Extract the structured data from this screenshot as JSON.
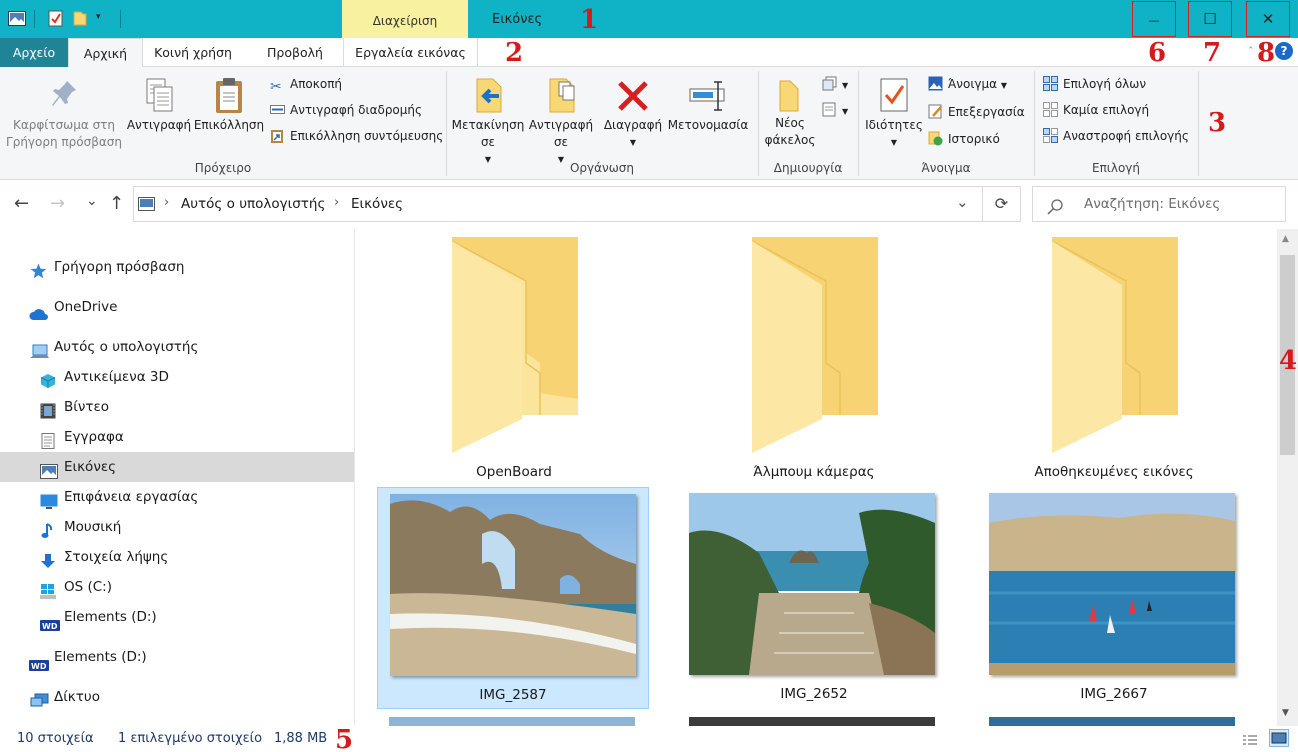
{
  "titlebar": {
    "quick_access_toolbar": [
      "properties-icon",
      "new-folder-icon",
      "customize-dropdown"
    ],
    "manage_tab": "Διαχείριση",
    "title": "Εικόνες",
    "minimize": "—",
    "maximize": "☐",
    "close": "✕"
  },
  "tabs": {
    "file": "Αρχείο",
    "home": "Αρχική",
    "share": "Κοινή χρήση",
    "view": "Προβολή",
    "picture_tools": "Εργαλεία εικόνας",
    "help": "?"
  },
  "ribbon": {
    "clipboard": {
      "group": "Πρόχειρο",
      "pin": "Καρφίτσωμα στη Γρήγορη πρόσβαση",
      "copy": "Αντιγραφή",
      "paste": "Επικόλληση",
      "cut": "Αποκοπή",
      "copy_path": "Αντιγραφή διαδρομής",
      "paste_shortcut": "Επικόλληση συντόμευσης"
    },
    "organize": {
      "group": "Οργάνωση",
      "move_to": "Μετακίνηση σε",
      "copy_to": "Αντιγραφή σε",
      "delete": "Διαγραφή",
      "rename": "Μετονομασία"
    },
    "new": {
      "group": "Δημιουργία",
      "new_folder": "Νέος φάκελος"
    },
    "open": {
      "group": "Άνοιγμα",
      "properties": "Ιδιότητες",
      "open": "Άνοιγμα",
      "edit": "Επεξεργασία",
      "history": "Ιστορικό"
    },
    "select": {
      "group": "Επιλογή",
      "select_all": "Επιλογή όλων",
      "select_none": "Καμία επιλογή",
      "invert": "Αναστροφή επιλογής"
    }
  },
  "address": {
    "back": "←",
    "forward": "→",
    "recent": "⌄",
    "up": "↑",
    "crumbs": [
      "Αυτός ο υπολογιστής",
      "Εικόνες"
    ],
    "separator": "›",
    "dropdown": "⌄",
    "refresh": "⟳",
    "search_placeholder": "Αναζήτηση: Εικόνες"
  },
  "navpane": {
    "items": [
      {
        "label": "Γρήγορη πρόσβαση",
        "icon": "star-icon"
      },
      {
        "label": "OneDrive",
        "icon": "cloud-icon"
      },
      {
        "label": "Αυτός ο υπολογιστής",
        "icon": "computer-icon"
      },
      {
        "label": "Αντικείμενα 3D",
        "icon": "cube-icon"
      },
      {
        "label": "Βίντεο",
        "icon": "film-icon"
      },
      {
        "label": "Εγγραφα",
        "icon": "document-icon"
      },
      {
        "label": "Εικόνες",
        "icon": "pictures-icon",
        "selected": true
      },
      {
        "label": "Επιφάνεια εργασίας",
        "icon": "desktop-icon"
      },
      {
        "label": "Μουσική",
        "icon": "music-note-icon"
      },
      {
        "label": "Στοιχεία λήψης",
        "icon": "download-arrow-icon"
      },
      {
        "label": "OS (C:)",
        "icon": "windows-drive-icon"
      },
      {
        "label": "Elements (D:)",
        "icon": "wd-drive-icon"
      },
      {
        "label": "Elements (D:)",
        "icon": "wd-drive-icon"
      },
      {
        "label": "Δίκτυο",
        "icon": "network-icon"
      }
    ]
  },
  "content": {
    "folders": [
      "OpenBoard",
      "Άλμπουμ κάμερας",
      "Αποθηκευμένες εικόνες"
    ],
    "photos": [
      {
        "name": "IMG_2587",
        "selected": true
      },
      {
        "name": "IMG_2652",
        "selected": false
      },
      {
        "name": "IMG_2667",
        "selected": false
      }
    ]
  },
  "status": {
    "count": "10 στοιχεία",
    "selected": "1 επιλεγμένο στοιχείο",
    "size": "1,88 MB"
  },
  "annotations": [
    "1",
    "2",
    "3",
    "4",
    "5",
    "6",
    "7",
    "8"
  ],
  "colors": {
    "titlebar": "#0fb3c5",
    "manage_tab": "#f7f1a0",
    "file_tab": "#1f8496",
    "annotation_red": "#d41a1a",
    "selection": "#cce8ff"
  }
}
